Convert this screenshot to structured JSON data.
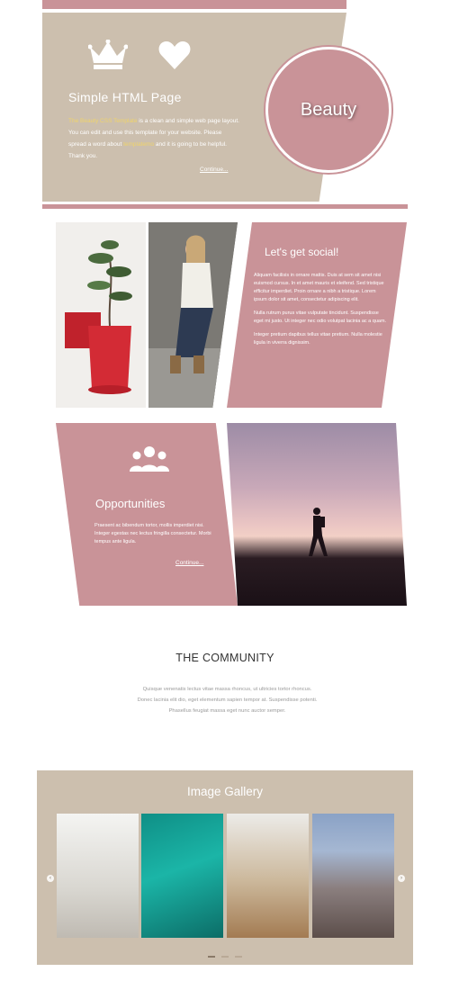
{
  "colors": {
    "accent_pink": "#c99398",
    "beige": "#ccbfae",
    "highlight": "#f0d46b"
  },
  "hero": {
    "icons": [
      "crown-icon",
      "heart-icon"
    ],
    "title": "Simple HTML Page",
    "text_highlight_1": "The Beauty CSS Template",
    "text_part_1": " is a clean and simple web page layout. You can edit and use this template for your website. Please spread a word about ",
    "text_highlight_2": "templatemo",
    "text_part_2": " and it is going to be helpful. Thank you.",
    "continue_label": "Continue...",
    "badge": "Beauty"
  },
  "social": {
    "title": "Let's get social!",
    "paragraphs": [
      "Aliquam facilisis in ornare mattis. Duis at sem sit amet nisi euismod cursus. In et amet mauris et eleifend. Sed tristique efficitur imperdiet. Proin ornare a nibh a tristique. Lorem ipsum dolor sit amet, consectetur adipiscing elit.",
      "Nulla rutrum purus vitae vulputate tincidunt. Suspendisse eget mi justo. Ut integer nec odio volutpat lacinia ac a quam.",
      "Integer pretium dapibus tellus vitae pretium. Nulla molestie ligula in viverra dignissim."
    ]
  },
  "opportunities": {
    "icon": "people-icon",
    "title": "Opportunities",
    "text": "Praesent ac bibendum tortor, mollis imperdiet nisi. Integer egestas nec lectus fringilla consectetur. Morbi tempus ante ligula.",
    "continue_label": "Continue..."
  },
  "community": {
    "title": "THE COMMUNITY",
    "text": "Quisque venenatis lectus vitae massa rhoncus, ut ultricies tortor rhoncus. Donec lacinia elit dio, eget elementum sapien tempor at. Suspendisse potenti. Phasellus feugiat massa eget nunc auctor semper."
  },
  "gallery": {
    "title": "Image Gallery",
    "images": [
      "alley-photo",
      "neon-pose-photo",
      "surfer-photo",
      "village-photo"
    ],
    "dots": 3,
    "active_dot": 1
  }
}
